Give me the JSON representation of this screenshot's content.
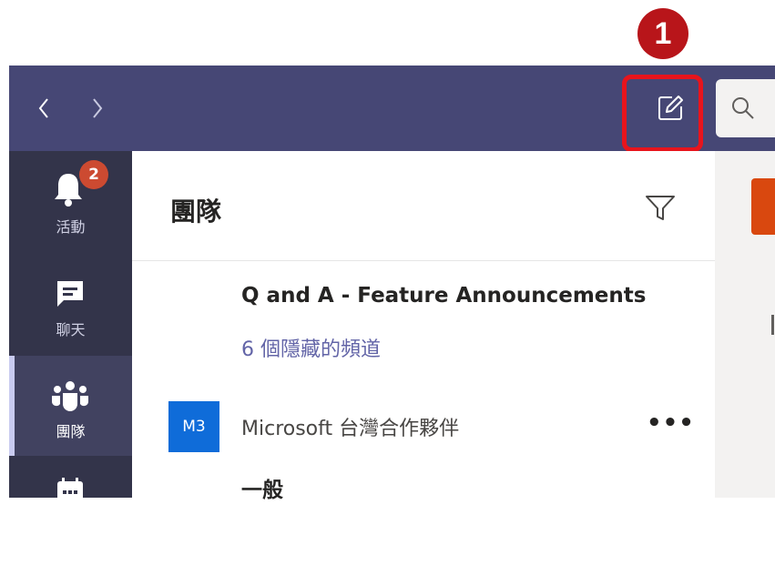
{
  "annotation": {
    "step_number": "1"
  },
  "topbar": {
    "back_icon": "chevron-left-icon",
    "forward_icon": "chevron-right-icon",
    "compose_icon": "compose-edit-icon",
    "search_icon": "search-icon"
  },
  "rail": {
    "items": [
      {
        "label": "活動",
        "icon": "bell-icon",
        "badge": "2"
      },
      {
        "label": "聊天",
        "icon": "chat-icon"
      },
      {
        "label": "團隊",
        "icon": "teams-icon",
        "active": true
      },
      {
        "label": "",
        "icon": "calendar-icon"
      }
    ]
  },
  "panel": {
    "title": "團隊",
    "filter_icon": "filter-icon",
    "team_title": "Q and A - Feature Announcements",
    "hidden_channels": "6 個隱藏的頻道",
    "team": {
      "avatar_text": "M3",
      "name": "Microsoft 台灣合作夥伴",
      "more": "•••"
    },
    "channel": "一般"
  },
  "colors": {
    "topbar": "#464775",
    "rail": "#33344a",
    "accent": "#6264a7",
    "annotation": "#e8141c",
    "badge": "#cc4a31"
  }
}
